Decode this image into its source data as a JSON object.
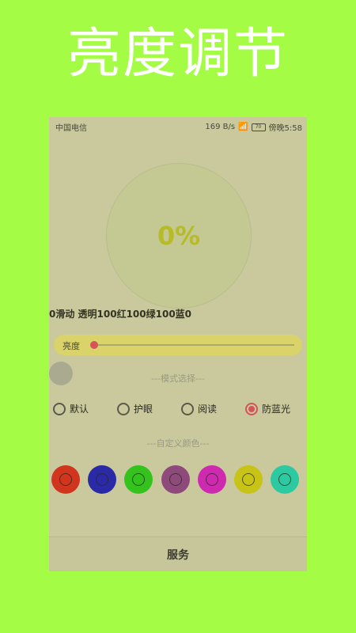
{
  "promo_title": "亮度调节",
  "status_bar": {
    "carrier": "中国电信",
    "speed": "169 B/s",
    "battery": "70",
    "time": "傍晚5:58"
  },
  "gauge": {
    "percent_text": "0%"
  },
  "info_line": "0滑动 透明100红100绿100蓝0",
  "brightness": {
    "label": "亮度",
    "value_fraction": 0.0
  },
  "mode_section": {
    "title": "---模式选择---",
    "options": [
      {
        "label": "默认",
        "checked": false
      },
      {
        "label": "护眼",
        "checked": false
      },
      {
        "label": "阅读",
        "checked": false
      },
      {
        "label": "防蓝光",
        "checked": true
      }
    ]
  },
  "color_section": {
    "title": "---自定义颜色---",
    "swatches": [
      {
        "color": "#d2351d"
      },
      {
        "color": "#2b2aa6"
      },
      {
        "color": "#34c21c"
      },
      {
        "color": "#8f4a7c"
      },
      {
        "color": "#cd2ab0"
      },
      {
        "color": "#c8c417"
      },
      {
        "color": "#2dc9a0"
      }
    ]
  },
  "bottom_bar": {
    "label": "服务"
  }
}
